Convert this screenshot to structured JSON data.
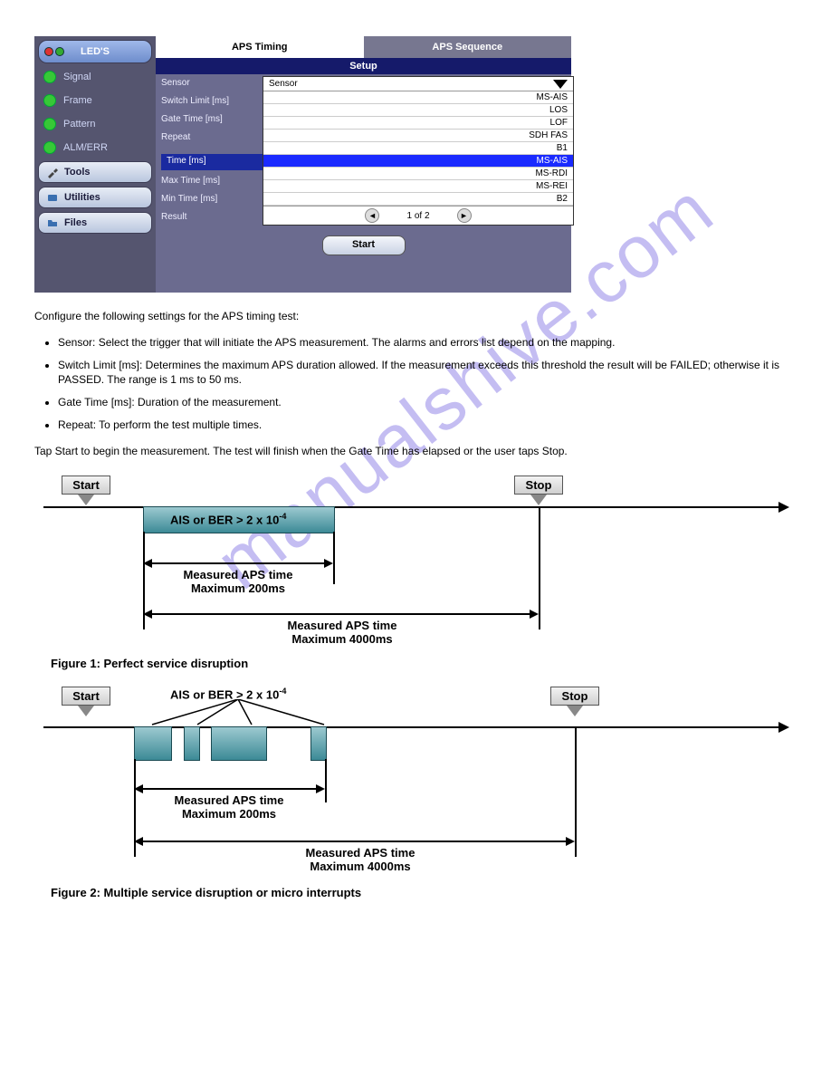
{
  "app": {
    "sidebar": {
      "leds_label": "LED'S",
      "statuses": [
        "Signal",
        "Frame",
        "Pattern",
        "ALM/ERR"
      ],
      "tools": [
        "Tools",
        "Utilities",
        "Files"
      ]
    },
    "tabs": {
      "active": "APS Timing",
      "inactive": "APS Sequence"
    },
    "setup_label": "Setup",
    "labels_col": [
      "Sensor",
      "Switch Limit [ms]",
      "Gate Time [ms]",
      "Repeat"
    ],
    "blue_labels": [
      "Time [ms]",
      "Max Time [ms]",
      "Min Time [ms]",
      "Result"
    ],
    "dropdown": {
      "header": "Sensor",
      "items": [
        "MS-AIS",
        "LOS",
        "LOF",
        "SDH FAS",
        "B1",
        "MS-AIS",
        "MS-RDI",
        "MS-REI",
        "B2"
      ],
      "selected_index": 5,
      "pager": "1 of 2"
    },
    "start_label": "Start"
  },
  "text": {
    "intro": "Configure the following settings for the APS timing test:",
    "bullets": [
      "Sensor: Select the trigger that will initiate the APS measurement. The alarms and errors list depend on the mapping.",
      "Switch Limit [ms]: Determines the maximum APS duration allowed. If the measurement exceeds this threshold the result will be FAILED; otherwise it is PASSED. The range is 1 ms to 50 ms.",
      "Gate Time [ms]: Duration of the measurement.",
      "Repeat: To perform the test multiple times."
    ],
    "after": "Tap Start to begin the measurement. The test will finish when the Gate Time has elapsed or the user taps Stop."
  },
  "fig1": {
    "start": "Start",
    "stop": "Stop",
    "block_label": "AIS or BER > 2 x 10",
    "block_label_exp": "-4",
    "dim1a": "Measured APS time",
    "dim1b": "Maximum 200ms",
    "dim2a": "Measured APS time",
    "dim2b": "Maximum 4000ms",
    "caption": "Figure 1: Perfect service disruption"
  },
  "fig2": {
    "start": "Start",
    "stop": "Stop",
    "toplabel": "AIS or BER > 2 x 10",
    "toplabel_exp": "-4",
    "dim1a": "Measured APS time",
    "dim1b": "Maximum 200ms",
    "dim2a": "Measured APS time",
    "dim2b": "Maximum 4000ms",
    "caption": "Figure 2: Multiple service disruption or micro interrupts"
  },
  "footer": {
    "a": " ",
    "b": " "
  }
}
